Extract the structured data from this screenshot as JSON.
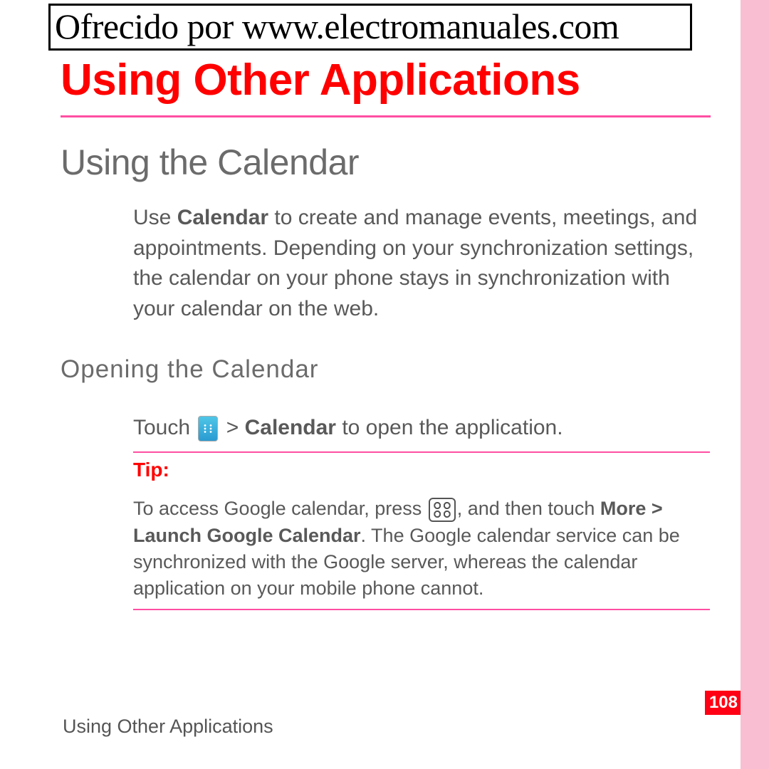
{
  "watermark": "Ofrecido por www.electromanuales.com",
  "chapter_title": "Using Other Applications",
  "section_title": "Using the Calendar",
  "intro": {
    "pre": "Use ",
    "bold": "Calendar",
    "post": " to create and manage events, meetings, and appointments. Depending on your synchronization settings, the calendar on your phone stays in synchronization with your calendar on the web."
  },
  "subsection_title": "Opening  the  Calendar",
  "touch": {
    "pre": "Touch  ",
    "mid": "  > ",
    "bold": "Calendar",
    "post": " to open the application."
  },
  "tip_label": "Tip:",
  "tip": {
    "pre": "To access Google calendar,  press ",
    "mid": ", and then touch ",
    "bold1": "More > Launch Google Calendar",
    "post": ". The Google calendar service can be synchronized with the Google server, whereas the calendar application on your mobile phone cannot."
  },
  "footer": "Using Other Applications",
  "page_number": "108"
}
